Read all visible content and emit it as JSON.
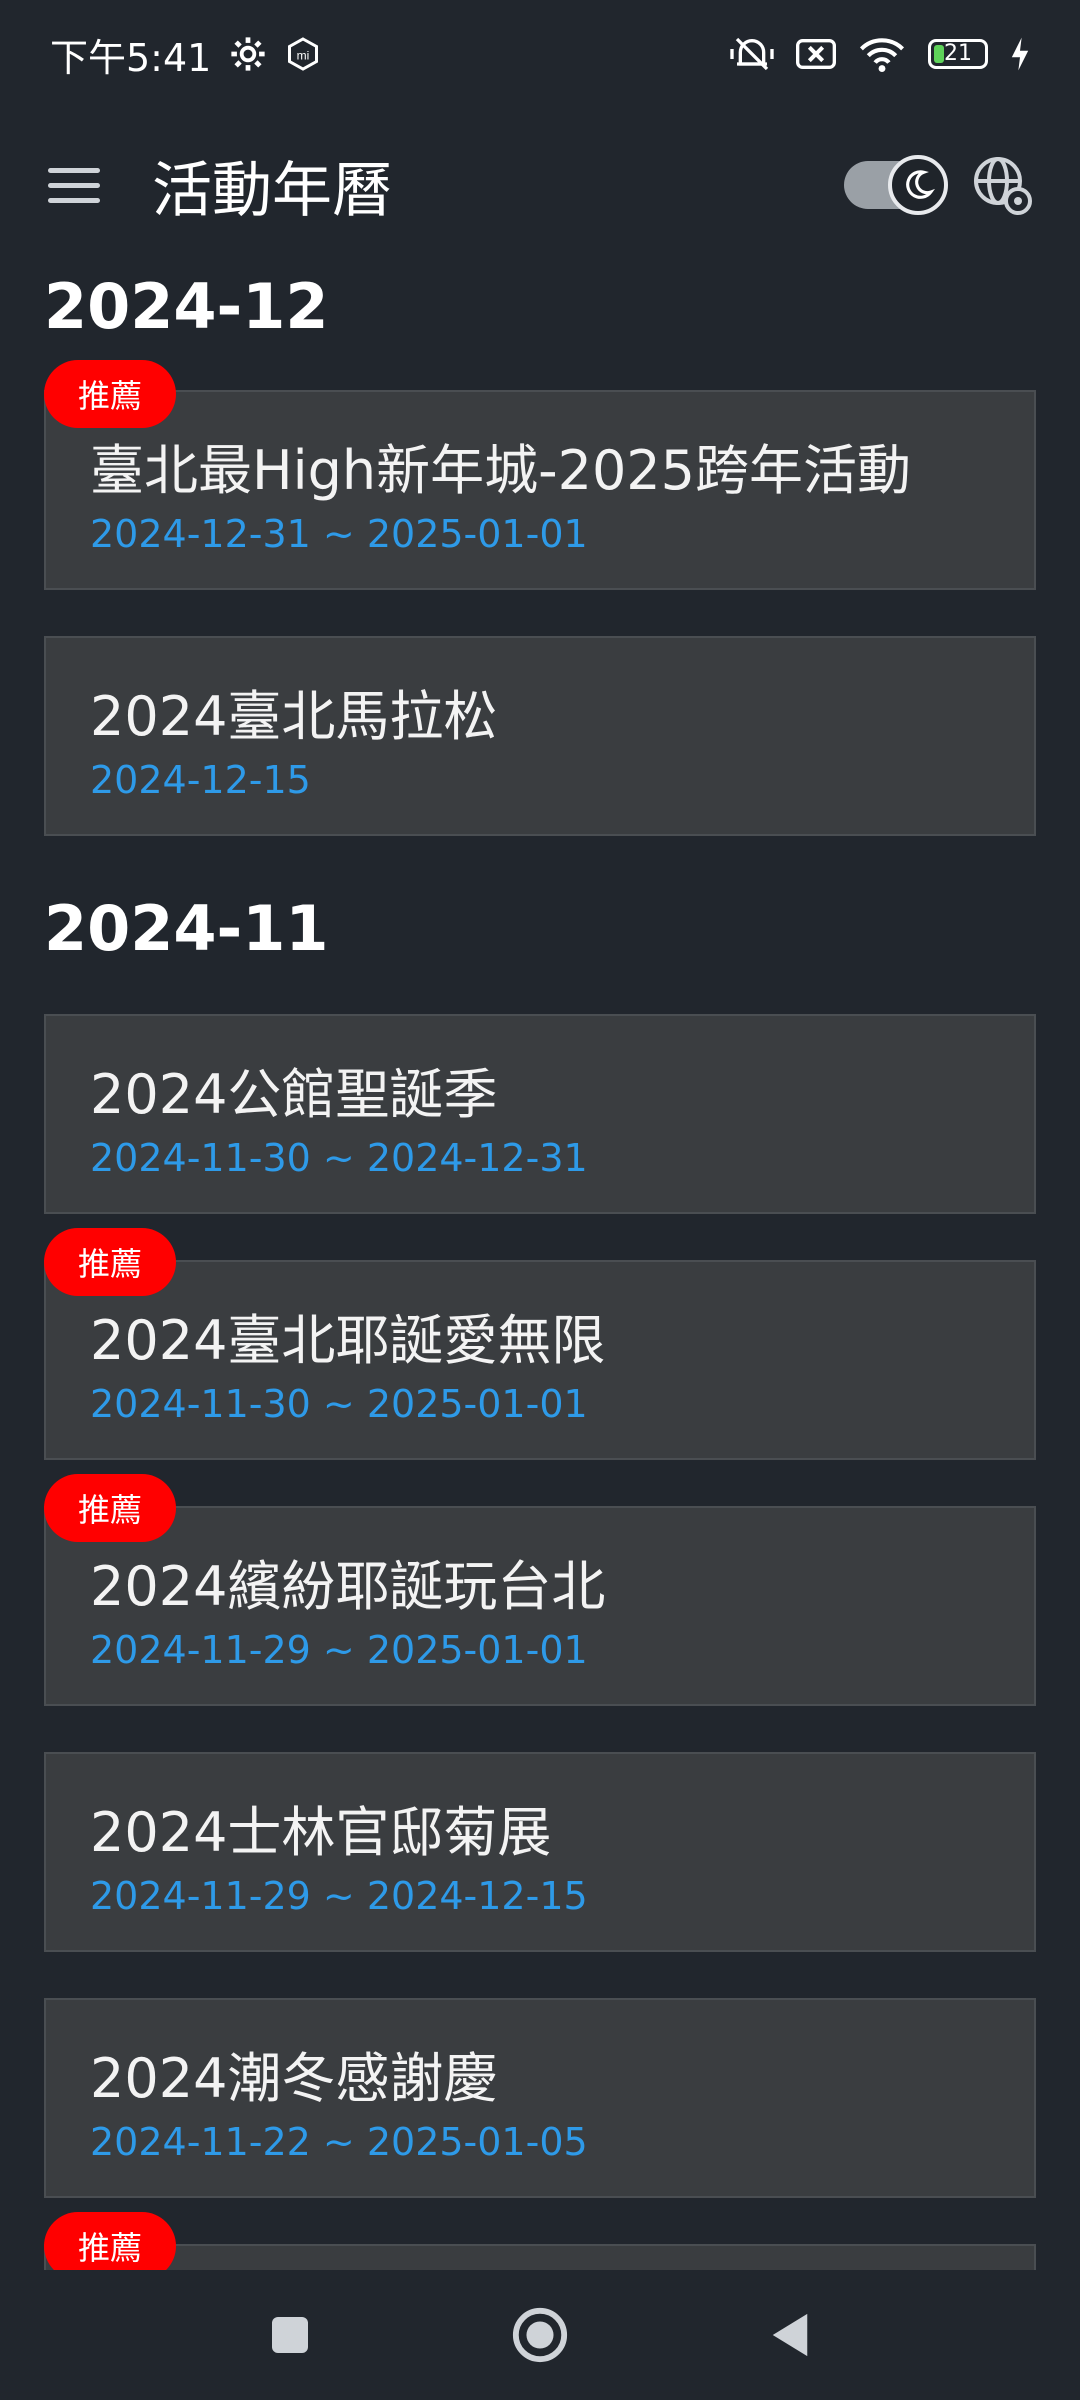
{
  "status_bar": {
    "time": "下午5:41",
    "battery_level": "21",
    "icons": [
      "gear-icon",
      "mi-icon",
      "mute-vibrate-icon",
      "sim-off-icon",
      "wifi-icon",
      "battery-icon",
      "charging-icon"
    ]
  },
  "app_bar": {
    "title": "活動年曆",
    "icons": [
      "menu-icon",
      "dark-mode-toggle",
      "language-settings-icon"
    ]
  },
  "badge_label": "推薦",
  "sections": [
    {
      "month": "2024-12",
      "events": [
        {
          "title": "臺北最High新年城-2025跨年活動",
          "date": "2024-12-31 ~ 2025-01-01",
          "recommended": true
        },
        {
          "title": "2024臺北馬拉松",
          "date": "2024-12-15",
          "recommended": false
        }
      ]
    },
    {
      "month": "2024-11",
      "events": [
        {
          "title": "2024公館聖誕季",
          "date": "2024-11-30 ~ 2024-12-31",
          "recommended": false
        },
        {
          "title": "2024臺北耶誕愛無限",
          "date": "2024-11-30 ~ 2025-01-01",
          "recommended": true
        },
        {
          "title": "2024繽紛耶誕玩台北",
          "date": "2024-11-29 ~ 2025-01-01",
          "recommended": true
        },
        {
          "title": "2024士林官邸菊展",
          "date": "2024-11-29 ~ 2024-12-15",
          "recommended": false
        },
        {
          "title": "2024潮冬感謝慶",
          "date": "2024-11-22 ~ 2025-01-05",
          "recommended": false
        },
        {
          "title": "",
          "date": "",
          "recommended": true
        }
      ]
    }
  ],
  "nav_bar": {
    "icons": [
      "recents-icon",
      "home-icon",
      "back-icon"
    ]
  }
}
